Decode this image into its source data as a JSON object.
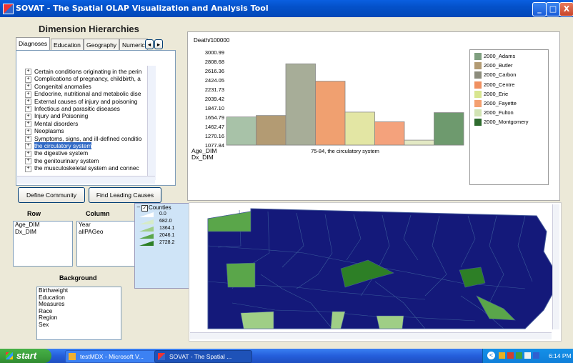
{
  "window": {
    "title": "SOVAT - The Spatial OLAP Visualization and Analysis Tool",
    "buttons": [
      "_",
      "□",
      "X"
    ]
  },
  "dimension_panel": {
    "title": "Dimension Hierarchies",
    "tabs": [
      "Diagnoses",
      "Education",
      "Geography",
      "Numeric"
    ],
    "tree_items": [
      "Certain conditions originating in the perin",
      "Complications of pregnancy, childbirth, a",
      "Congenital anomalies",
      "Endocrine, nutritional and metabolic dise",
      "External causes of injury and poisoning",
      "Infectious and parasitic diseases",
      "Injury and Poisoning",
      "Mental disorders",
      "Neoplasms",
      "Symptoms, signs, and ill-defined conditio",
      "the circulatory system",
      "the digestive system",
      "the genitourinary system",
      "the musculoskeletal system and connec"
    ],
    "selected_index": 10,
    "define_button": "Define Community",
    "leading_button": "Find Leading Causes"
  },
  "row_col": {
    "row_header": "Row",
    "column_header": "Column",
    "row_items": [
      "Age_DIM",
      "Dx_DIM"
    ],
    "column_items": [
      "Year",
      "allPAGeo"
    ],
    "background_header": "Background",
    "background_items": [
      "Birthweight",
      "Education",
      "Measures",
      "Race",
      "Region",
      "Sex"
    ]
  },
  "chart_data": {
    "type": "bar",
    "ylabel": "Death/100000",
    "yticks": [
      "3000.99",
      "2808.68",
      "2616.36",
      "2424.05",
      "2231.73",
      "2039.42",
      "1847.10",
      "1654.79",
      "1462.47",
      "1270.16",
      "1077.84"
    ],
    "ylim": [
      1077.84,
      3000.99
    ],
    "category": "75-84, the circulatory system",
    "row_labels": [
      "Age_DIM",
      "Dx_DIM"
    ],
    "series": [
      {
        "name": "2000_Adams",
        "value": 1660,
        "color": "#a8c2a8"
      },
      {
        "name": "2000_Butler",
        "value": 1690,
        "color": "#b39b73"
      },
      {
        "name": "2000_Carbon",
        "value": 2760,
        "color": "#a7ad98"
      },
      {
        "name": "2000_Centre",
        "value": 2400,
        "color": "#f0a070"
      },
      {
        "name": "2000_Erie",
        "value": 1760,
        "color": "#e3e6a4"
      },
      {
        "name": "2000_Fayette",
        "value": 1560,
        "color": "#f4a27c"
      },
      {
        "name": "2000_Fulton",
        "value": 1180,
        "color": "#e3e9c4"
      },
      {
        "name": "2000_Montgomery",
        "value": 1750,
        "color": "#6e9a6e"
      }
    ],
    "legend_colors": [
      "#7f9f7f",
      "#b39b73",
      "#8c8c7c",
      "#f09060",
      "#d8e690",
      "#f4a070",
      "#d2e4b4",
      "#2e6b2e"
    ]
  },
  "map": {
    "layer_label": "Counties",
    "layer_checked": true,
    "legend_values": [
      "0.0",
      "682.0",
      "1364.1",
      "2046.1",
      "2728.2"
    ],
    "legend_colors": [
      "#ffffff",
      "#d6ebc8",
      "#9fce86",
      "#5aa64a",
      "#2d7f26"
    ],
    "base_color": "#14197a"
  },
  "taskbar": {
    "start_label": "start",
    "tasks": [
      "testMDX - Microsoft V...",
      "SOVAT - The Spatial ..."
    ],
    "clock": "6:14 PM"
  }
}
